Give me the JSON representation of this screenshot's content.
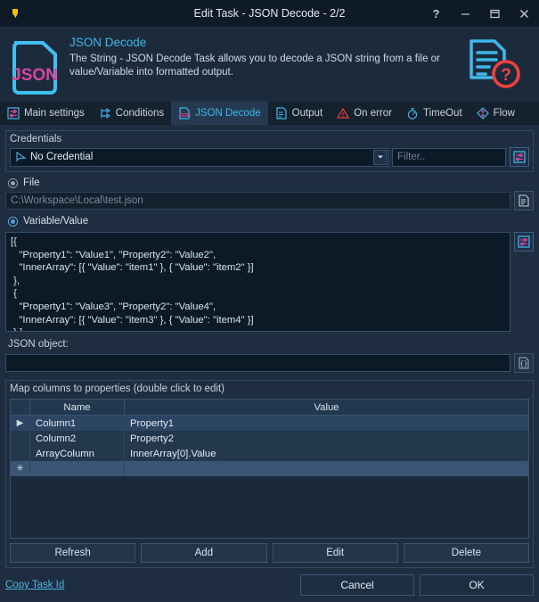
{
  "titlebar": {
    "app_logo": "v-logo-icon",
    "title": "Edit Task - JSON Decode - 2/2",
    "help_label": "?",
    "minimize_label": "–",
    "maximize_label": "□",
    "close_label": "✕"
  },
  "header": {
    "left_icon": "json-document-icon",
    "left_icon_text": "JSON",
    "title": "JSON Decode",
    "description": "The String - JSON Decode Task allows you to decode a JSON string from a file or value/Variable into formatted output.",
    "right_icon": "document-help-icon"
  },
  "tabs": [
    {
      "label": "Main settings",
      "icon": "sliders-icon",
      "active": false
    },
    {
      "label": "Conditions",
      "icon": "branch-icon",
      "active": false
    },
    {
      "label": "JSON Decode",
      "icon": "json-file-icon",
      "active": true
    },
    {
      "label": "Output",
      "icon": "document-icon",
      "active": false
    },
    {
      "label": "On error",
      "icon": "warning-triangle-icon",
      "active": false
    },
    {
      "label": "TimeOut",
      "icon": "stopwatch-icon",
      "active": false
    },
    {
      "label": "Flow",
      "icon": "diamond-arrow-icon",
      "active": false
    }
  ],
  "credentials": {
    "group_label": "Credentials",
    "selected": "No Credential",
    "dropdown_icon": "chevron-down-icon",
    "cursor_icon": "cursor-arrow-icon",
    "filter_placeholder": "Filter..",
    "filter_value": "",
    "settings_icon": "sliders-icon"
  },
  "source": {
    "file_option": {
      "label": "File",
      "selected": false
    },
    "file_path_placeholder": "C:\\Workspace\\Local\\test.json",
    "file_path_value": "",
    "browse_icon": "document-browse-icon",
    "variable_option": {
      "label": "Variable/Value",
      "selected": true
    },
    "json_text": "[{\n   \"Property1\": \"Value1\", \"Property2\": \"Value2\",\n   \"InnerArray\": [{ \"Value\": \"item1\" }, { \"Value\": \"item2\" }]\n },\n {\n   \"Property1\": \"Value3\", \"Property2\": \"Value4\",\n   \"InnerArray\": [{ \"Value\": \"item3\" }, { \"Value\": \"item4\" }]\n } ]",
    "variable_settings_icon": "sliders-icon"
  },
  "json_object": {
    "label": "JSON object:",
    "value": "",
    "brace_icon": "curly-braces-icon"
  },
  "mapping": {
    "group_label": "Map columns to properties (double click to edit)",
    "columns": [
      "Name",
      "Value"
    ],
    "rows": [
      {
        "gutter": "▶",
        "name": "Column1",
        "value": "Property1"
      },
      {
        "gutter": "",
        "name": "Column2",
        "value": "Property2"
      },
      {
        "gutter": "",
        "name": "ArrayColumn",
        "value": "InnerArray[0].Value"
      },
      {
        "gutter": "✳",
        "name": "",
        "value": ""
      }
    ],
    "buttons": [
      "Refresh",
      "Add",
      "Edit",
      "Delete"
    ]
  },
  "footer": {
    "copy_task_id": "Copy Task Id",
    "cancel": "Cancel",
    "ok": "OK"
  },
  "colors": {
    "accent": "#3fb7e8",
    "window_bg": "#1e2d3f",
    "titlebar_bg": "#0f1a27",
    "magenta": "#d845a0",
    "error_red": "#f0413f",
    "logo_yellow": "#f2c00f"
  }
}
